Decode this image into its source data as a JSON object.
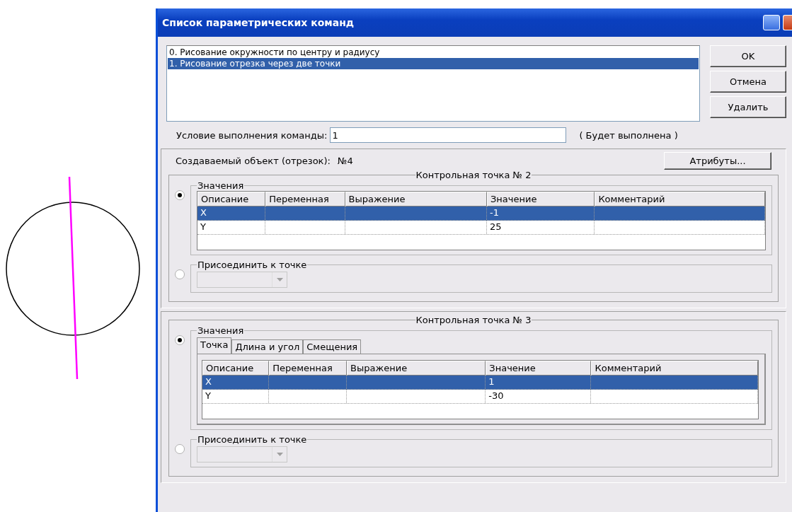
{
  "window": {
    "title": "Список параметрических команд"
  },
  "commands": [
    {
      "label": "0. Рисование окружности по центру и радиусу",
      "selected": false
    },
    {
      "label": "1. Рисование отрезка через две точки",
      "selected": true
    }
  ],
  "buttons": [
    "OK",
    "Отмена",
    "Удалить"
  ],
  "condition": {
    "label": "Условие выполнения команды:",
    "value": "1",
    "status": "( Будет выполнена )"
  },
  "object": {
    "label": "Создаваемый объект (отрезок):",
    "number": "№4",
    "button": "Атрибуты..."
  },
  "points": [
    {
      "title": "Контрольная точка № 2",
      "values_label": "Значения",
      "attach_label": "Присоединить к точке",
      "mode": [
        {
          "kind": "values",
          "selected": true
        },
        {
          "kind": "attach",
          "selected": false
        }
      ],
      "columns": [
        "Описание",
        "Переменная",
        "Выражение",
        "Значение",
        "Комментарий"
      ],
      "rows": [
        {
          "cells": [
            "X",
            "",
            "",
            "-1",
            ""
          ],
          "selected": true
        },
        {
          "cells": [
            "Y",
            "",
            "",
            "25",
            ""
          ],
          "selected": false
        }
      ]
    },
    {
      "title": "Контрольная точка № 3",
      "values_label": "Значения",
      "attach_label": "Присоединить к точке",
      "mode": [
        {
          "kind": "values",
          "selected": true
        },
        {
          "kind": "attach",
          "selected": false
        }
      ],
      "tabs": [
        {
          "label": "Точка",
          "selected": true
        },
        {
          "label": "Длина и угол",
          "selected": false
        },
        {
          "label": "Смещения",
          "selected": false
        }
      ],
      "columns": [
        "Описание",
        "Переменная",
        "Выражение",
        "Значение",
        "Комментарий"
      ],
      "rows": [
        {
          "cells": [
            "X",
            "",
            "",
            "1",
            ""
          ],
          "selected": true
        },
        {
          "cells": [
            "Y",
            "",
            "",
            "-30",
            ""
          ],
          "selected": false
        }
      ]
    }
  ]
}
